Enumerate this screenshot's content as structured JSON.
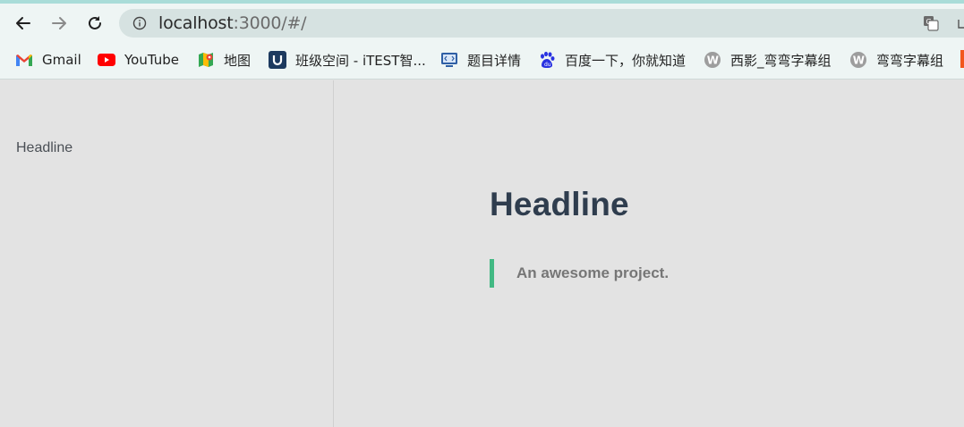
{
  "browser": {
    "url_host": "localhost",
    "url_rest": ":3000/#/"
  },
  "bookmarks": [
    {
      "label": "Gmail",
      "icon": "gmail-icon"
    },
    {
      "label": "YouTube",
      "icon": "youtube-icon"
    },
    {
      "label": "地图",
      "icon": "maps-icon"
    },
    {
      "label": "班级空间 - iTEST智...",
      "icon": "itest-icon"
    },
    {
      "label": "题目详情",
      "icon": "code-icon"
    },
    {
      "label": "百度一下，你就知道",
      "icon": "baidu-icon"
    },
    {
      "label": "西影_弯弯字幕组",
      "icon": "w-icon"
    },
    {
      "label": "弯弯字幕组",
      "icon": "w-icon"
    }
  ],
  "sidebar": {
    "items": [
      {
        "label": "Headline"
      }
    ]
  },
  "main": {
    "title": "Headline",
    "quote": "An awesome project."
  },
  "colors": {
    "accent": "#42b983",
    "heading": "#2f3d4e",
    "background": "#e3e3e3"
  }
}
